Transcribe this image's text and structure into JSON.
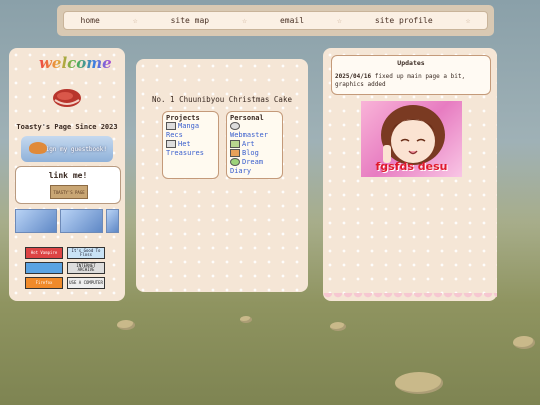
{
  "nav": {
    "items": [
      "home",
      "site map",
      "email",
      "site profile"
    ],
    "separator": "☆"
  },
  "sidebar": {
    "welcome": "welcome",
    "since": "Toasty's Page Since 2023",
    "guestbook": "sign my guestbook!",
    "linkme": "link me!",
    "linkme_button": "TOASTY'S PAGE",
    "banners": [
      "",
      "",
      ""
    ],
    "buttons": [
      {
        "label": "Hot Vampire",
        "color": "#d44"
      },
      {
        "label": "It's Good To Floss",
        "color": "#c9e3f6"
      },
      {
        "label": "",
        "color": "#5aa3e2"
      },
      {
        "label": "INTERNET ARCHIVE",
        "color": "#ddd"
      },
      {
        "label": "Firefox",
        "color": "#f08a2a"
      },
      {
        "label": "USE A COMPUTER",
        "color": "#eee"
      }
    ]
  },
  "main": {
    "title": "No. 1 Chuunibyou Christmas Cake",
    "projects": {
      "heading": "Projects",
      "links": [
        "Manga Recs",
        "Het Treasures"
      ]
    },
    "personal": {
      "heading": "Personal",
      "links": [
        "Webmaster",
        "Art",
        "Blog",
        "Dream Diary"
      ]
    }
  },
  "updates": {
    "title": "Updates",
    "date": "2025/04/16",
    "text": "fixed up main page a bit, graphics added"
  },
  "image": {
    "caption": "fgsfds desu"
  },
  "colors": {
    "panel": "#f5e6d6",
    "link": "#3a5fcd",
    "accent": "#e0182a"
  }
}
